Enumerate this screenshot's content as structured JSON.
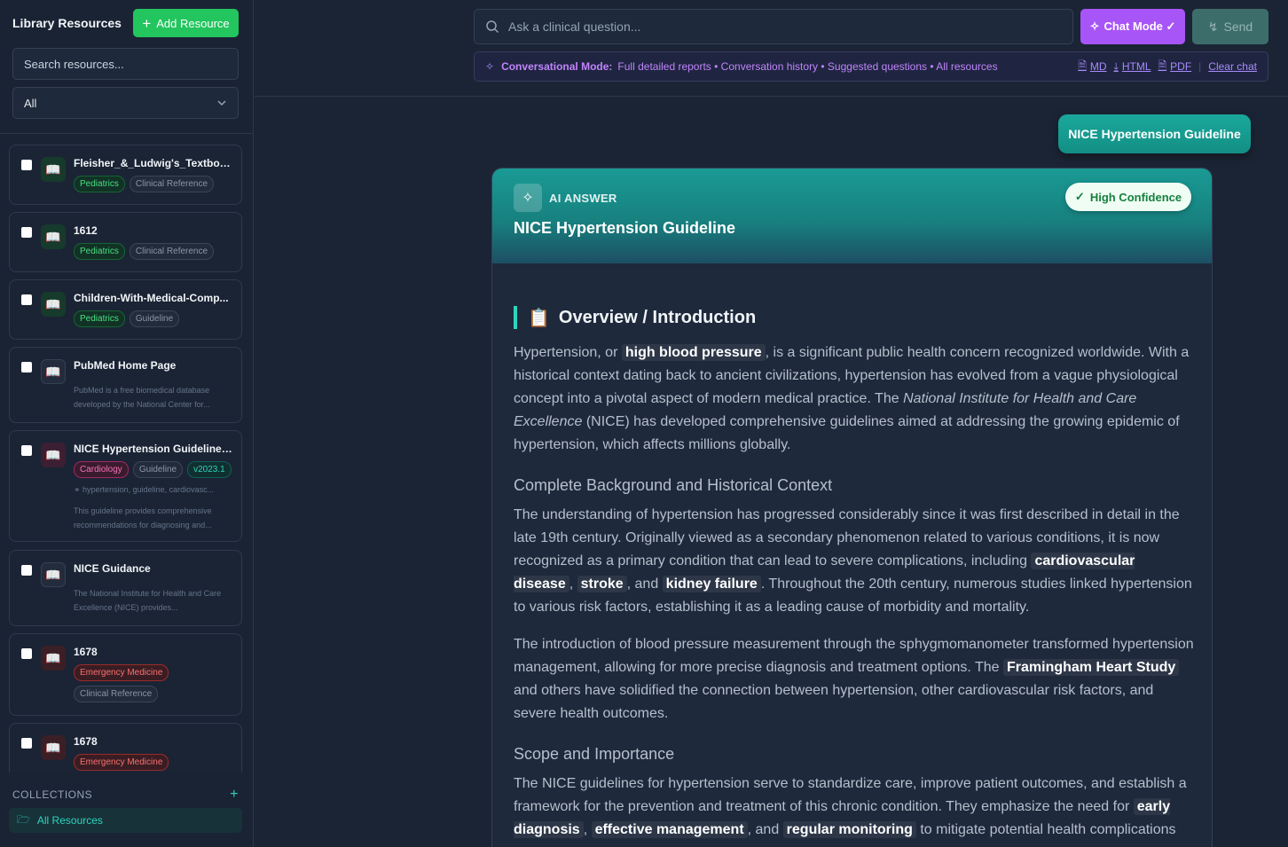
{
  "sidebar": {
    "title": "Library Resources",
    "add_button": "Add Resource",
    "search_placeholder": "Search resources...",
    "filter_value": "All",
    "resources": [
      {
        "name": "Fleisher_&_Ludwig's_Textbook...",
        "tags": [
          "Pediatrics",
          "Clinical Reference"
        ],
        "icon": "book-icon",
        "accent": "green"
      },
      {
        "name": "1612",
        "tags": [
          "Pediatrics",
          "Clinical Reference"
        ],
        "icon": "book-icon",
        "accent": "green"
      },
      {
        "name": "Children-With-Medical-Comp...",
        "tags": [
          "Pediatrics",
          "Guideline"
        ],
        "icon": "book-icon",
        "accent": "green"
      },
      {
        "name": "PubMed Home Page",
        "description": "PubMed is a free biomedical database developed by the National Center for...",
        "icon": "book-icon",
        "accent": "grey"
      },
      {
        "name": "NICE Hypertension Guideline ...",
        "tags": [
          "Cardiology",
          "Guideline",
          "v2023.1"
        ],
        "keywords": "hypertension, guideline, cardiovasc...",
        "description": "This guideline provides comprehensive recommendations for diagnosing and...",
        "icon": "book-icon",
        "accent": "pink"
      },
      {
        "name": "NICE Guidance",
        "description": "The National Institute for Health and Care Excellence (NICE) provides...",
        "icon": "book-icon",
        "accent": "grey"
      },
      {
        "name": "1678",
        "tags": [
          "Emergency Medicine",
          "Clinical Reference"
        ],
        "icon": "book-icon",
        "accent": "red"
      },
      {
        "name": "1678",
        "tags": [
          "Emergency Medicine"
        ],
        "icon": "book-icon",
        "accent": "red"
      }
    ],
    "collections_label": "COLLECTIONS",
    "all_resources": "All Resources"
  },
  "topbar": {
    "ask_placeholder": "Ask a clinical question...",
    "chat_mode": "Chat Mode ✓",
    "send": "Send",
    "mode_label": "Conversational Mode:",
    "mode_desc": "Full detailed reports • Conversation history • Suggested questions • All resources",
    "links": {
      "md": "MD",
      "html": "HTML",
      "pdf": "PDF",
      "clear": "Clear chat"
    }
  },
  "chat": {
    "user_query": "NICE Hypertension Guideline",
    "answer_label": "AI ANSWER",
    "answer_title": "NICE Hypertension Guideline",
    "confidence": "High Confidence",
    "overview_heading": "Overview / Introduction",
    "background_heading": "Complete Background and Historical Context",
    "scope_heading": "Scope and Importance"
  },
  "colors": {
    "accent_teal": "#14b8a6",
    "chat_mode": "#a855f7",
    "add_green": "#22c55e"
  }
}
